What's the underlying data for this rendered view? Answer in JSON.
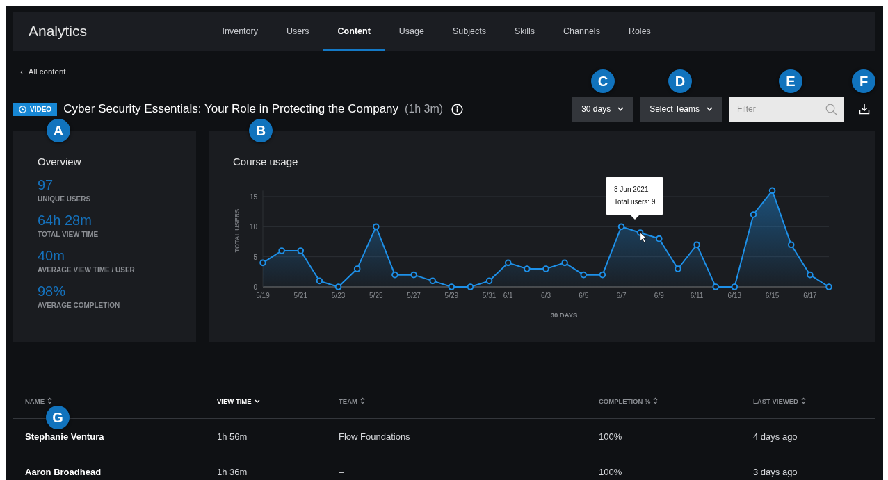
{
  "header": {
    "title": "Analytics",
    "tabs": [
      {
        "label": "Inventory",
        "selected": false
      },
      {
        "label": "Users",
        "selected": false
      },
      {
        "label": "Content",
        "selected": true
      },
      {
        "label": "Usage",
        "selected": false
      },
      {
        "label": "Subjects",
        "selected": false
      },
      {
        "label": "Skills",
        "selected": false
      },
      {
        "label": "Channels",
        "selected": false
      },
      {
        "label": "Roles",
        "selected": false
      }
    ]
  },
  "back_link": {
    "icon": "‹",
    "label": "All content"
  },
  "content": {
    "badge": "VIDEO",
    "title": "Cyber Security Essentials: Your Role in Protecting the Company",
    "duration": "(1h 3m)"
  },
  "controls": {
    "period": "30 days",
    "teams": "Select Teams",
    "filter": {
      "placeholder": "Filter"
    }
  },
  "callouts": [
    "A",
    "B",
    "C",
    "D",
    "E",
    "F",
    "G"
  ],
  "overview": {
    "title": "Overview",
    "stats": [
      {
        "value": "97",
        "label": "UNIQUE USERS"
      },
      {
        "value": "64h 28m",
        "label": "TOTAL VIEW TIME"
      },
      {
        "value": "40m",
        "label": "AVERAGE VIEW TIME / USER"
      },
      {
        "value": "98%",
        "label": "AVERAGE COMPLETION"
      }
    ]
  },
  "course_usage": {
    "title": "Course usage",
    "tooltip": {
      "date": "8 Jun 2021",
      "text": "Total users: 9"
    },
    "chart_data": {
      "type": "area",
      "xlabel": "30 DAYS",
      "ylabel": "TOTAL USERS",
      "categories": [
        "5/19",
        null,
        "5/21",
        null,
        "5/23",
        null,
        "5/25",
        null,
        "5/27",
        null,
        "5/29",
        null,
        "5/31",
        "6/1",
        null,
        "6/3",
        null,
        "6/5",
        null,
        "6/7",
        null,
        "6/9",
        null,
        "6/11",
        null,
        "6/13",
        null,
        "6/15",
        null,
        "6/17",
        null
      ],
      "series": [
        {
          "color": "#1e90e8",
          "values": [
            4,
            6,
            6,
            1,
            0,
            3,
            10,
            2,
            2,
            1,
            0,
            0,
            1,
            4,
            3,
            3,
            4,
            2,
            2,
            10,
            9,
            8,
            3,
            7,
            0,
            0,
            12,
            16,
            7,
            2,
            0
          ]
        }
      ],
      "grid": true,
      "ylim": [
        0,
        16
      ],
      "yticks": [
        0,
        5,
        10,
        15
      ]
    }
  },
  "table": {
    "columns": [
      {
        "label": "NAME",
        "sorted": false
      },
      {
        "label": "VIEW TIME",
        "sorted": true
      },
      {
        "label": "TEAM",
        "sorted": false
      },
      {
        "label": "COMPLETION %",
        "sorted": false
      },
      {
        "label": "LAST VIEWED",
        "sorted": false
      }
    ],
    "rows": [
      [
        "Stephanie Ventura",
        "1h 56m",
        "Flow Foundations",
        "100%",
        "4 days ago"
      ],
      [
        "Aaron Broadhead",
        "1h 36m",
        "–",
        "100%",
        "3 days ago"
      ]
    ]
  }
}
